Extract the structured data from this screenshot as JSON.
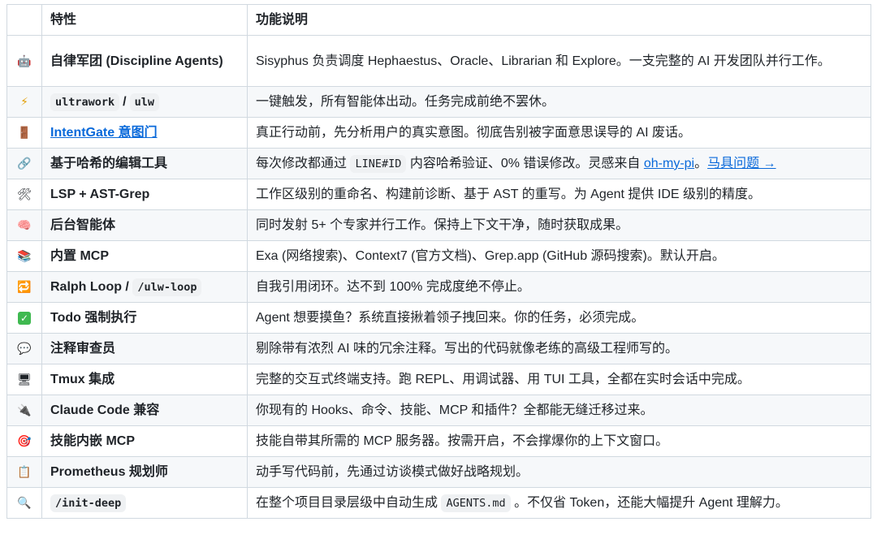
{
  "header": {
    "col_feature": "特性",
    "col_description": "功能说明"
  },
  "rows": [
    {
      "icon": "robot-icon",
      "glyph": "🤖",
      "feature": "自律军团 (Discipline Agents)",
      "desc": "Sisyphus 负责调度 Hephaestus、Oracle、Librarian 和 Explore。一支完整的 AI 开发团队并行工作。"
    },
    {
      "icon": "lightning-icon",
      "glyph": "⚡",
      "feature_code1": "ultrawork",
      "feature_sep": "/",
      "feature_code2": "ulw",
      "desc": "一键触发，所有智能体出动。任务完成前绝不罢休。"
    },
    {
      "icon": "door-icon",
      "glyph": "🚪",
      "feature_link": "IntentGate 意图门",
      "desc": "真正行动前，先分析用户的真实意图。彻底告别被字面意思误导的 AI 废话。"
    },
    {
      "icon": "link-icon",
      "glyph": "🔗",
      "feature": "基于哈希的编辑工具",
      "desc_pre": "每次修改都通过",
      "desc_code": "LINE#ID",
      "desc_mid": "内容哈希验证、0% 错误修改。灵感来自",
      "desc_link1": "oh-my-pi",
      "desc_sep": "。",
      "desc_link2": "马具问题 →"
    },
    {
      "icon": "tools-icon",
      "glyph": "🛠",
      "feature": "LSP + AST-Grep",
      "desc": "工作区级别的重命名、构建前诊断、基于 AST 的重写。为 Agent 提供 IDE 级别的精度。"
    },
    {
      "icon": "brain-icon",
      "glyph": "🧠",
      "feature": "后台智能体",
      "desc": "同时发射 5+ 个专家并行工作。保持上下文干净，随时获取成果。"
    },
    {
      "icon": "books-icon",
      "glyph": "📚",
      "feature": "内置 MCP",
      "desc": "Exa (网络搜索)、Context7 (官方文档)、Grep.app (GitHub 源码搜索)。默认开启。"
    },
    {
      "icon": "loop-icon",
      "glyph": "🔁",
      "feature_text": "Ralph Loop /",
      "feature_code": "/ulw-loop",
      "desc": "自我引用闭环。达不到 100% 完成度绝不停止。"
    },
    {
      "icon": "check-icon",
      "glyph": "✓",
      "feature": "Todo 强制执行",
      "desc": "Agent 想要摸鱼？系统直接揪着领子拽回来。你的任务，必须完成。"
    },
    {
      "icon": "speech-bubble-icon",
      "glyph": "💬",
      "feature": "注释审查员",
      "desc": "剔除带有浓烈 AI 味的冗余注释。写出的代码就像老练的高级工程师写的。"
    },
    {
      "icon": "monitor-icon",
      "glyph": "🖥",
      "feature": "Tmux 集成",
      "desc": "完整的交互式终端支持。跑 REPL、用调试器、用 TUI 工具，全都在实时会话中完成。"
    },
    {
      "icon": "plug-icon",
      "glyph": "🔌",
      "feature": "Claude Code 兼容",
      "desc": "你现有的 Hooks、命令、技能、MCP 和插件？全都能无缝迁移过来。"
    },
    {
      "icon": "target-icon",
      "glyph": "🎯",
      "feature": "技能内嵌 MCP",
      "desc": "技能自带其所需的 MCP 服务器。按需开启，不会撑爆你的上下文窗口。"
    },
    {
      "icon": "clipboard-icon",
      "glyph": "📋",
      "feature": "Prometheus 规划师",
      "desc": "动手写代码前，先通过访谈模式做好战略规划。"
    },
    {
      "icon": "magnifier-icon",
      "glyph": "🔍",
      "feature_code": "/init-deep",
      "desc_pre": "在整个项目目录层级中自动生成",
      "desc_code": "AGENTS.md",
      "desc_post": "。不仅省 Token，还能大幅提升 Agent 理解力。"
    }
  ]
}
